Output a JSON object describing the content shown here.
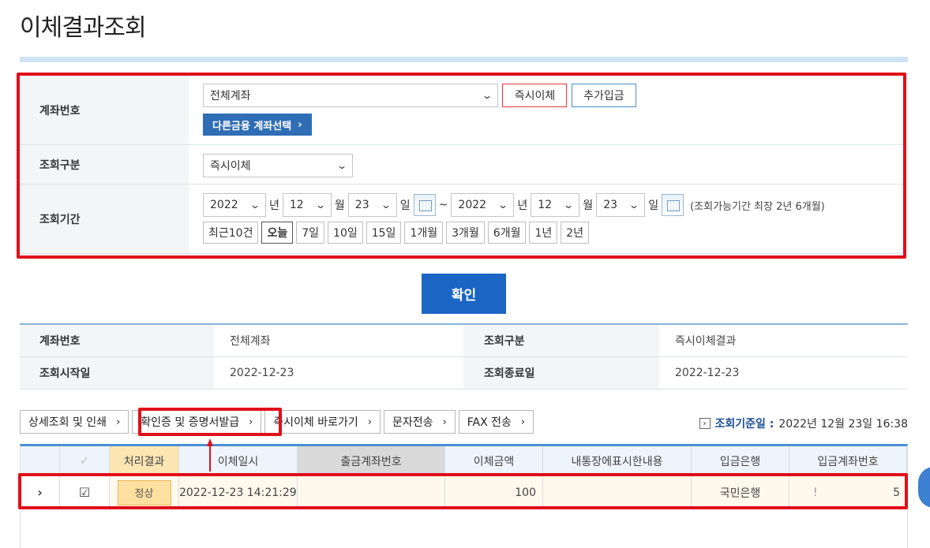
{
  "page": {
    "title": "이체결과조회"
  },
  "search": {
    "account_label": "계좌번호",
    "account_value": "전체계좌",
    "instant_transfer_btn": "즉시이체",
    "add_deposit_btn": "추가입금",
    "other_bank_btn": "다른금융 계좌선택",
    "type_label": "조회구분",
    "type_value": "즉시이체",
    "period_label": "조회기간",
    "start": {
      "year": "2022",
      "month": "12",
      "day": "23"
    },
    "end": {
      "year": "2022",
      "month": "12",
      "day": "23"
    },
    "unit_year": "년",
    "unit_month": "월",
    "unit_day": "일",
    "tilde": "~",
    "period_note": "(조회가능기간 최장 2년 6개월)",
    "quick_periods": [
      "최근10건",
      "오늘",
      "7일",
      "10일",
      "15일",
      "1개월",
      "3개월",
      "6개월",
      "1년",
      "2년"
    ]
  },
  "confirm_btn": "확인",
  "summary": {
    "account_label": "계좌번호",
    "account_value": "전체계좌",
    "type_label": "조회구분",
    "type_value": "즉시이체결과",
    "start_label": "조회시작일",
    "start_value": "2022-12-23",
    "end_label": "조회종료일",
    "end_value": "2022-12-23"
  },
  "actions": {
    "detail_print": "상세조회 및 인쇄",
    "certificate": "확인증 및 증명서발급",
    "go_instant": "즉시이체 바로가기",
    "sms": "문자전송",
    "fax": "FAX 전송",
    "basis_label": "조회기준일 :",
    "basis_value": "2022년 12월 23일 16:38"
  },
  "grid": {
    "headers": [
      "처리결과",
      "이체일시",
      "출금계좌번호",
      "이체금액",
      "내통장에표시한내용",
      "입금은행",
      "입금계좌번호"
    ],
    "rows": [
      {
        "result": "정상",
        "datetime": "2022-12-23 14:21:29",
        "from_account": "",
        "amount": "100",
        "memo": "",
        "bank": "국민은행",
        "to_account_a": "!",
        "to_account_b": "5"
      }
    ]
  },
  "colors": {
    "accent": "#1b65c4",
    "highlight": "#e0101a"
  }
}
